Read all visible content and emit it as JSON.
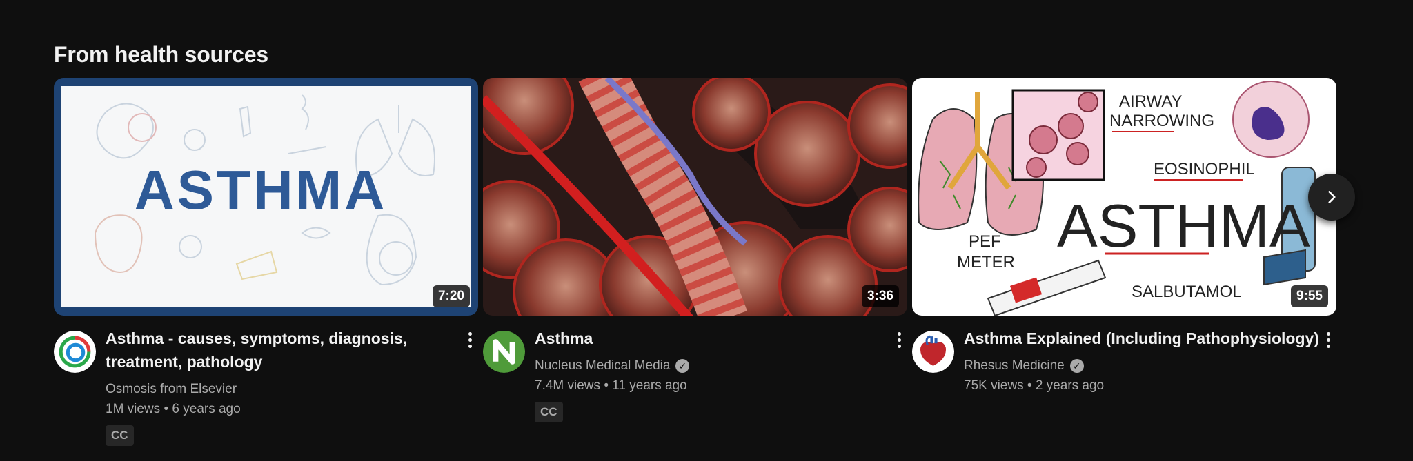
{
  "shelf": {
    "title": "From health sources",
    "next_icon": "chevron-right-icon"
  },
  "videos": [
    {
      "title": "Asthma - causes, symptoms, diagnosis, treatment, pathology",
      "thumbnail_text": "ASTHMA",
      "duration": "7:20",
      "channel": "Osmosis from Elsevier",
      "verified": false,
      "views": "1M views",
      "age": "6 years ago",
      "badge": "CC"
    },
    {
      "title": "Asthma",
      "duration": "3:36",
      "channel": "Nucleus Medical Media",
      "verified": true,
      "views": "7.4M views",
      "age": "11 years ago",
      "badge": "CC"
    },
    {
      "title": "Asthma Explained (Including Pathophysiology)",
      "thumbnail_text": {
        "main": "ASTHMA",
        "airway_1": "AIRWAY",
        "airway_2": "NARROWING",
        "eosinophil": "EOSINOPHIL",
        "pef_1": "PEF",
        "pef_2": "METER",
        "salbutamol": "SALBUTAMOL"
      },
      "duration": "9:55",
      "channel": "Rhesus Medicine",
      "verified": true,
      "views": "75K views",
      "age": "2 years ago"
    }
  ],
  "colors": {
    "background": "#0f0f0f",
    "text_primary": "#f1f1f1",
    "text_secondary": "#aaaaaa",
    "badge_bg": "#272727"
  }
}
